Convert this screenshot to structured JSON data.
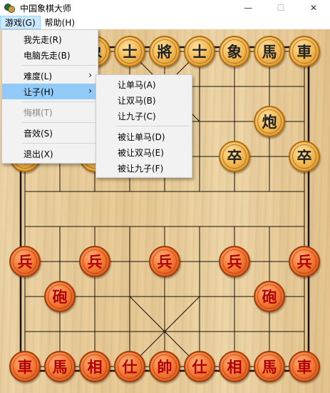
{
  "window": {
    "title": "中国象棋大师",
    "minimize": "—",
    "maximize": "☐",
    "close": "✕"
  },
  "menubar": [
    {
      "label": "游戏(G)",
      "active": true
    },
    {
      "label": "帮助(H)",
      "active": false
    }
  ],
  "game_menu": {
    "items": [
      {
        "label": "我先走(R)",
        "type": "item"
      },
      {
        "label": "电脑先走(B)",
        "type": "item"
      },
      {
        "type": "sep"
      },
      {
        "label": "难度(L)",
        "type": "submenu"
      },
      {
        "label": "让子(H)",
        "type": "submenu",
        "highlight": true
      },
      {
        "type": "sep"
      },
      {
        "label": "悔棋(T)",
        "type": "item",
        "disabled": true
      },
      {
        "type": "sep"
      },
      {
        "label": "音效(S)",
        "type": "item"
      },
      {
        "type": "sep"
      },
      {
        "label": "退出(X)",
        "type": "item"
      }
    ],
    "submenu_arrow": "›"
  },
  "handicap_submenu": {
    "items": [
      {
        "label": "让单马(A)",
        "type": "item"
      },
      {
        "label": "让双马(B)",
        "type": "item"
      },
      {
        "label": "让九子(C)",
        "type": "item"
      },
      {
        "type": "sep"
      },
      {
        "label": "被让单马(D)",
        "type": "item"
      },
      {
        "label": "被让双马(E)",
        "type": "item"
      },
      {
        "label": "被让九子(F)",
        "type": "item"
      }
    ]
  },
  "board": {
    "files": 9,
    "ranks": 10,
    "pieces": [
      {
        "side": "black",
        "char": "象",
        "file": 2,
        "rank": 0
      },
      {
        "side": "black",
        "char": "士",
        "file": 3,
        "rank": 0
      },
      {
        "side": "black",
        "char": "將",
        "file": 4,
        "rank": 0
      },
      {
        "side": "black",
        "char": "士",
        "file": 5,
        "rank": 0
      },
      {
        "side": "black",
        "char": "象",
        "file": 6,
        "rank": 0
      },
      {
        "side": "black",
        "char": "馬",
        "file": 7,
        "rank": 0
      },
      {
        "side": "black",
        "char": "車",
        "file": 8,
        "rank": 0
      },
      {
        "side": "black",
        "char": "炮",
        "file": 7,
        "rank": 2
      },
      {
        "side": "black",
        "char": "卒",
        "file": 0,
        "rank": 3
      },
      {
        "side": "black",
        "char": "卒",
        "file": 2,
        "rank": 3
      },
      {
        "side": "black",
        "char": "卒",
        "file": 4,
        "rank": 3
      },
      {
        "side": "black",
        "char": "卒",
        "file": 6,
        "rank": 3
      },
      {
        "side": "black",
        "char": "卒",
        "file": 8,
        "rank": 3
      },
      {
        "side": "red",
        "char": "兵",
        "file": 0,
        "rank": 6
      },
      {
        "side": "red",
        "char": "兵",
        "file": 2,
        "rank": 6
      },
      {
        "side": "red",
        "char": "兵",
        "file": 4,
        "rank": 6
      },
      {
        "side": "red",
        "char": "兵",
        "file": 6,
        "rank": 6
      },
      {
        "side": "red",
        "char": "兵",
        "file": 8,
        "rank": 6
      },
      {
        "side": "red",
        "char": "砲",
        "file": 1,
        "rank": 7
      },
      {
        "side": "red",
        "char": "砲",
        "file": 7,
        "rank": 7
      },
      {
        "side": "red",
        "char": "車",
        "file": 0,
        "rank": 9
      },
      {
        "side": "red",
        "char": "馬",
        "file": 1,
        "rank": 9
      },
      {
        "side": "red",
        "char": "相",
        "file": 2,
        "rank": 9
      },
      {
        "side": "red",
        "char": "仕",
        "file": 3,
        "rank": 9
      },
      {
        "side": "red",
        "char": "帥",
        "file": 4,
        "rank": 9
      },
      {
        "side": "red",
        "char": "仕",
        "file": 5,
        "rank": 9
      },
      {
        "side": "red",
        "char": "相",
        "file": 6,
        "rank": 9
      },
      {
        "side": "red",
        "char": "馬",
        "file": 7,
        "rank": 9
      },
      {
        "side": "red",
        "char": "車",
        "file": 8,
        "rank": 9
      }
    ]
  }
}
